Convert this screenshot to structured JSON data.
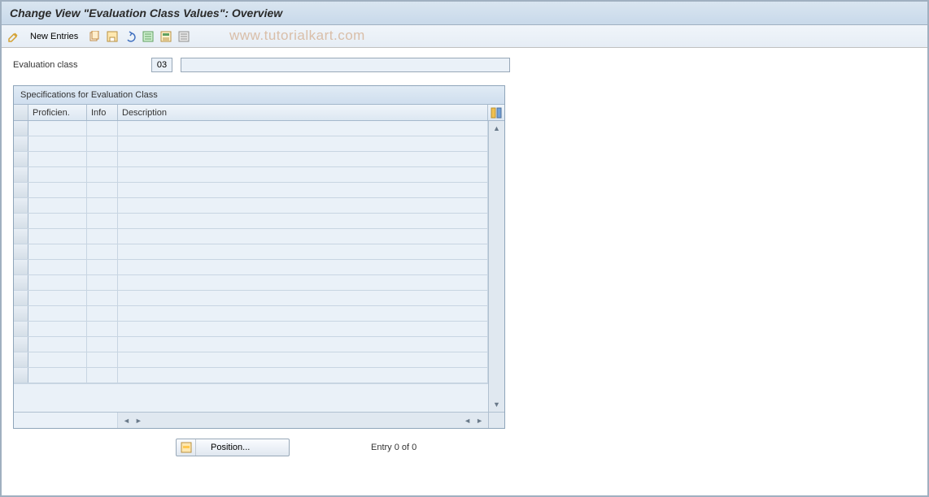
{
  "header": {
    "title": "Change View \"Evaluation Class Values\": Overview"
  },
  "toolbar": {
    "new_entries_label": "New Entries"
  },
  "watermark": "www.tutorialkart.com",
  "form": {
    "eval_class_label": "Evaluation class",
    "eval_class_value": "03",
    "eval_class_desc": ""
  },
  "table": {
    "panel_title": "Specifications for Evaluation Class",
    "columns": {
      "proficien": "Proficien.",
      "info": "Info",
      "description": "Description"
    },
    "rows": []
  },
  "footer": {
    "position_label": "Position...",
    "entry_status": "Entry 0 of 0"
  }
}
